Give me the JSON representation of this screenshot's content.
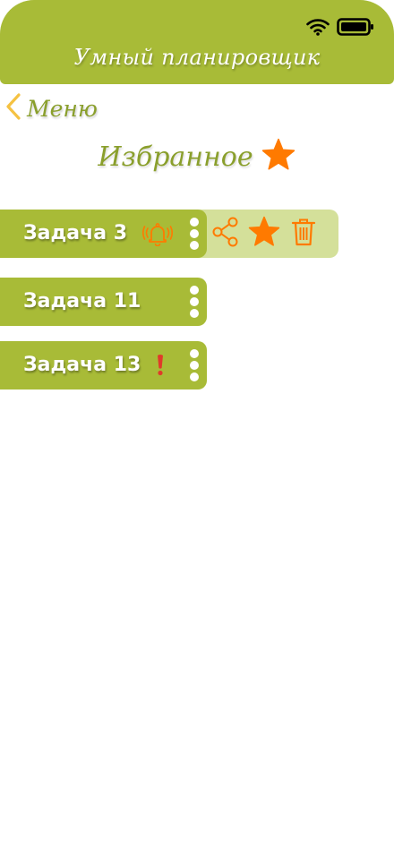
{
  "header": {
    "title": "Умный планировщик",
    "status_icons": [
      "wifi-icon",
      "battery-icon"
    ]
  },
  "nav": {
    "back_label": "Меню",
    "back_icon": "chevron-left-icon"
  },
  "page": {
    "title": "Избранное",
    "title_icon": "star-icon"
  },
  "tasks": [
    {
      "label": "Задача 3",
      "indicator": "bell-ringing-icon",
      "actions_open": true
    },
    {
      "label": "Задача 11",
      "indicator": "",
      "actions_open": false
    },
    {
      "label": "Задача 13",
      "indicator": "exclamation-icon",
      "actions_open": false
    }
  ],
  "task_actions": [
    "share-icon",
    "star-icon",
    "trash-icon"
  ],
  "colors": {
    "primary": "#a8bb37",
    "primary_light": "#d4e09a",
    "title_text": "#8a9f2c",
    "accent_orange": "#ff7a00",
    "back_chevron": "#f5c242",
    "alert_red": "#e03a2a"
  }
}
